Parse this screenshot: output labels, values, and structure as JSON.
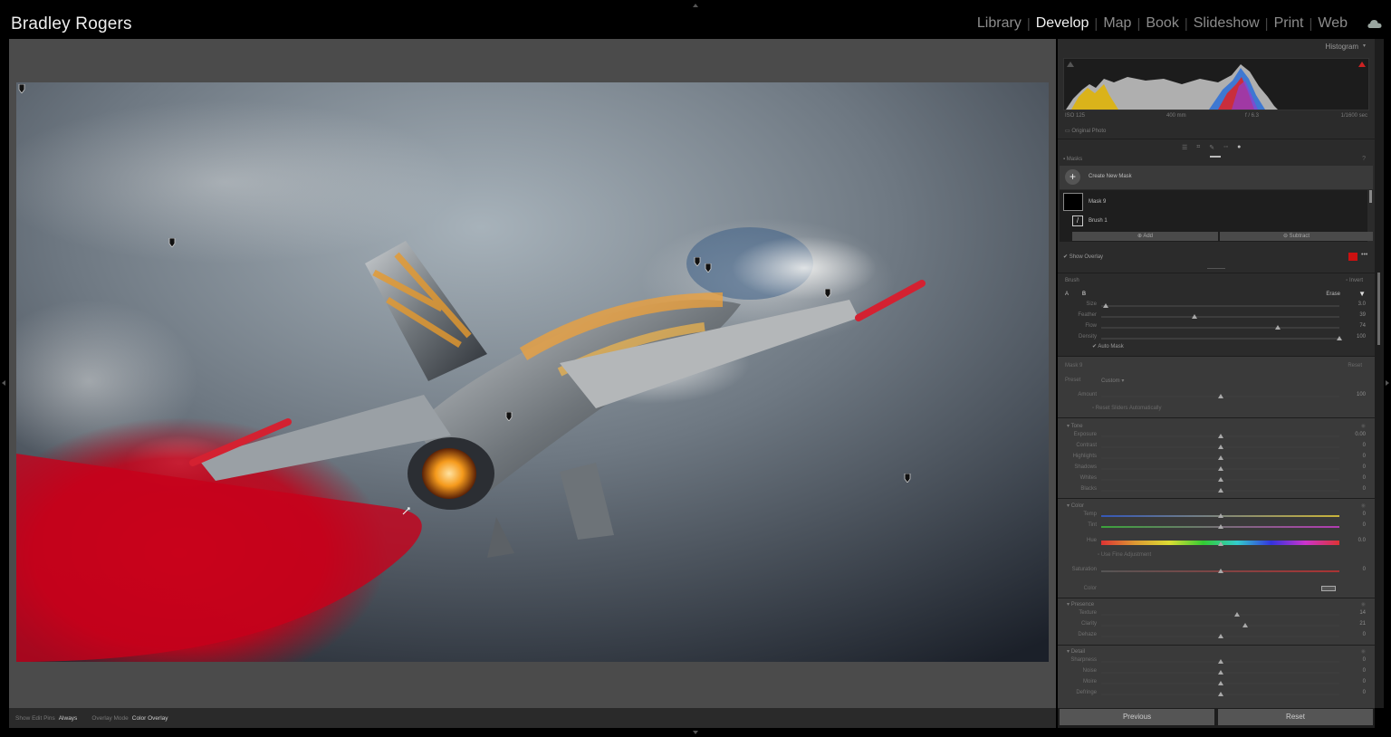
{
  "identity_plate": "Bradley Rogers",
  "modules": [
    "Library",
    "Develop",
    "Map",
    "Book",
    "Slideshow",
    "Print",
    "Web"
  ],
  "active_module": "Develop",
  "histogram": {
    "title": "Histogram",
    "iso": "ISO 125",
    "focal": "400 mm",
    "aperture": "f / 6.3",
    "shutter": "1/1600 sec",
    "original_photo": "Original Photo"
  },
  "masks": {
    "title": "Masks",
    "create_label": "Create New Mask",
    "mask_name": "Mask 9",
    "brush_name": "Brush 1",
    "add_label": "Add",
    "subtract_label": "Subtract",
    "show_overlay": "Show Overlay",
    "overlay_color": "#cc1111"
  },
  "brush": {
    "title": "Brush",
    "invert": "Invert",
    "tab_a": "A",
    "tab_b": "B",
    "erase": "Erase",
    "auto_mask": "Auto Mask",
    "sliders": [
      {
        "name": "Size",
        "value": "3.0",
        "pos": 0.02
      },
      {
        "name": "Feather",
        "value": "39",
        "pos": 0.39
      },
      {
        "name": "Flow",
        "value": "74",
        "pos": 0.74
      },
      {
        "name": "Density",
        "value": "100",
        "pos": 1.0
      }
    ]
  },
  "mask_settings": {
    "title": "Mask 9",
    "reset": "Reset",
    "preset_label": "Preset",
    "preset_value": "Custom",
    "amount_label": "Amount",
    "amount_value": "100",
    "reset_sliders": "Reset Sliders Automatically"
  },
  "tone": {
    "title": "Tone",
    "sliders": [
      {
        "name": "Exposure",
        "value": "0.00"
      },
      {
        "name": "Contrast",
        "value": "0"
      },
      {
        "name": "Highlights",
        "value": "0"
      },
      {
        "name": "Shadows",
        "value": "0"
      },
      {
        "name": "Whites",
        "value": "0"
      },
      {
        "name": "Blacks",
        "value": "0"
      }
    ]
  },
  "color": {
    "title": "Color",
    "temp_label": "Temp",
    "temp_value": "0",
    "tint_label": "Tint",
    "tint_value": "0",
    "hue_label": "Hue",
    "hue_value": "0.0",
    "fine_adjust": "Use Fine Adjustment",
    "saturation_label": "Saturation",
    "saturation_value": "0",
    "color_label": "Color"
  },
  "presence": {
    "title": "Presence",
    "sliders": [
      {
        "name": "Texture",
        "value": "14",
        "pos": 0.57
      },
      {
        "name": "Clarity",
        "value": "21",
        "pos": 0.605
      },
      {
        "name": "Dehaze",
        "value": "0",
        "pos": 0.5
      }
    ]
  },
  "detail": {
    "title": "Detail",
    "sliders": [
      {
        "name": "Sharpness",
        "value": "0"
      },
      {
        "name": "Noise",
        "value": "0"
      },
      {
        "name": "Moire",
        "value": "0"
      },
      {
        "name": "Defringe",
        "value": "0"
      }
    ]
  },
  "toolbar": {
    "show_edit_pins_label": "Show Edit Pins",
    "show_edit_pins_value": "Always",
    "overlay_mode_label": "Overlay Mode",
    "overlay_mode_value": "Color Overlay"
  },
  "buttons": {
    "previous": "Previous",
    "reset": "Reset"
  }
}
